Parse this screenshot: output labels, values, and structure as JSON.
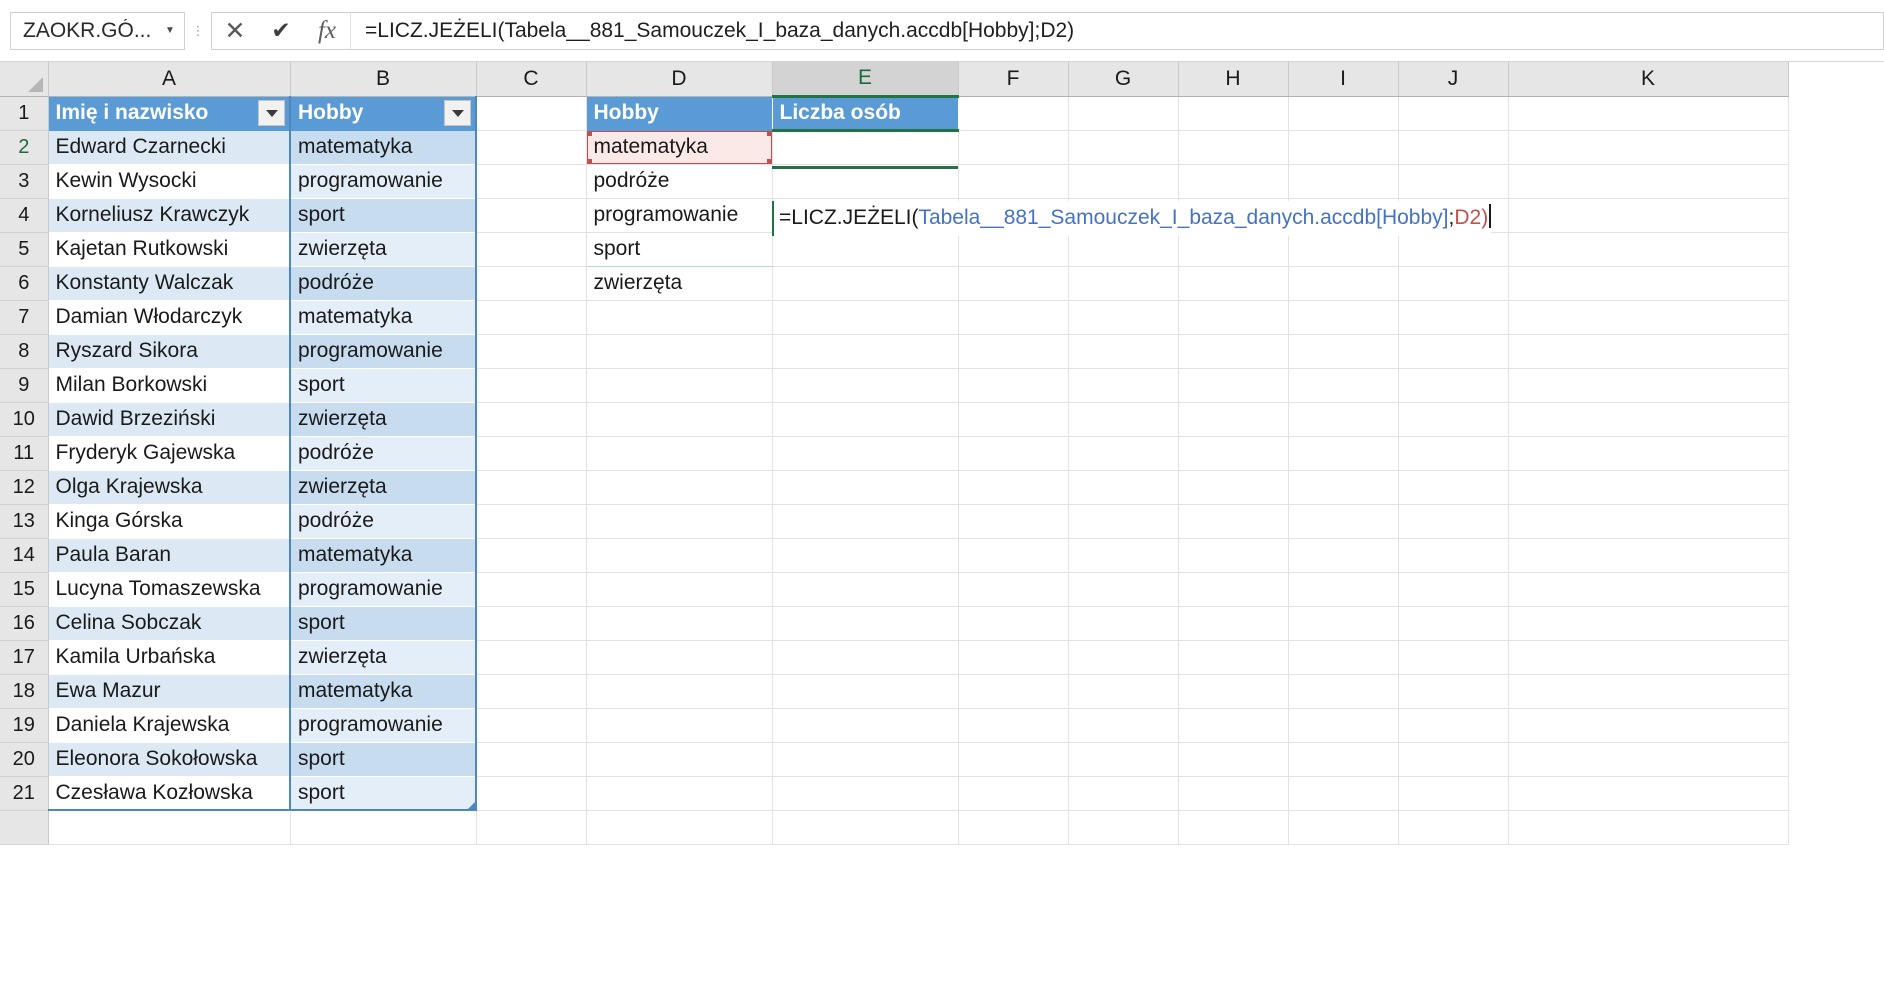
{
  "app": {
    "name": "Microsoft Excel",
    "mode": "formula-editing"
  },
  "formula_bar": {
    "name_box_value": "ZAOKR.GÓ...",
    "name_box_arrow": "chevron-down-icon",
    "cancel_label": "✕",
    "enter_label": "✔",
    "insert_function_label": "fx",
    "formula_text": "=LICZ.JEŻELI(Tabela__881_Samouczek_I_baza_danych.accdb[Hobby];D2)"
  },
  "grid": {
    "column_headers": [
      "A",
      "B",
      "C",
      "D",
      "E",
      "F",
      "G",
      "H",
      "I",
      "J",
      "K"
    ],
    "active_column": "E",
    "active_row": 2,
    "row_numbers": [
      1,
      2,
      3,
      4,
      5,
      6,
      7,
      8,
      9,
      10,
      11,
      12,
      13,
      14,
      15,
      16,
      17,
      18,
      19,
      20,
      21
    ]
  },
  "table": {
    "headers": {
      "a": "Imię i nazwisko",
      "b": "Hobby"
    },
    "filter_icon": "filter-dropdown-icon",
    "rows": [
      {
        "row": 2,
        "name": "Edward Czarnecki",
        "hobby": "matematyka"
      },
      {
        "row": 3,
        "name": "Kewin Wysocki",
        "hobby": "programowanie"
      },
      {
        "row": 4,
        "name": "Korneliusz Krawczyk",
        "hobby": "sport"
      },
      {
        "row": 5,
        "name": "Kajetan Rutkowski",
        "hobby": "zwierzęta"
      },
      {
        "row": 6,
        "name": "Konstanty Walczak",
        "hobby": "podróże"
      },
      {
        "row": 7,
        "name": "Damian Włodarczyk",
        "hobby": "matematyka"
      },
      {
        "row": 8,
        "name": "Ryszard Sikora",
        "hobby": "programowanie"
      },
      {
        "row": 9,
        "name": "Milan Borkowski",
        "hobby": "sport"
      },
      {
        "row": 10,
        "name": "Dawid Brzeziński",
        "hobby": "zwierzęta"
      },
      {
        "row": 11,
        "name": "Fryderyk Gajewska",
        "hobby": "podróże"
      },
      {
        "row": 12,
        "name": "Olga Krajewska",
        "hobby": "zwierzęta"
      },
      {
        "row": 13,
        "name": "Kinga Górska",
        "hobby": "podróże"
      },
      {
        "row": 14,
        "name": "Paula Baran",
        "hobby": "matematyka"
      },
      {
        "row": 15,
        "name": "Lucyna Tomaszewska",
        "hobby": "programowanie"
      },
      {
        "row": 16,
        "name": "Celina Sobczak",
        "hobby": "sport"
      },
      {
        "row": 17,
        "name": "Kamila Urbańska",
        "hobby": "zwierzęta"
      },
      {
        "row": 18,
        "name": "Ewa Mazur",
        "hobby": "matematyka"
      },
      {
        "row": 19,
        "name": "Daniela Krajewska",
        "hobby": "programowanie"
      },
      {
        "row": 20,
        "name": "Eleonora Sokołowska",
        "hobby": "sport"
      },
      {
        "row": 21,
        "name": "Czesława Kozłowska",
        "hobby": "sport"
      }
    ]
  },
  "report": {
    "header_d": "Hobby",
    "header_e": "Liczba osób",
    "hobby_values": [
      "matematyka",
      "podróże",
      "programowanie",
      "sport",
      "zwierzęta"
    ],
    "active_cell_formula": {
      "prefix": "=LICZ.JEŻELI(",
      "reference": "Tabela__881_Samouczek_I_baza_danych.accdb[Hobby]",
      "separator": ";",
      "argument": "D2",
      "suffix": ")"
    },
    "highlighted_reference_cell": "D2"
  },
  "colors": {
    "table_header_blue": "#5b9bd5",
    "table_band_blue": "#dce9f5",
    "table_border_blue": "#4e87bd",
    "active_green": "#217346",
    "reference_red": "#c0504d",
    "reference_fill": "#fbe9e7",
    "formula_blue": "#4472c4",
    "header_gray": "#e6e6e6"
  }
}
